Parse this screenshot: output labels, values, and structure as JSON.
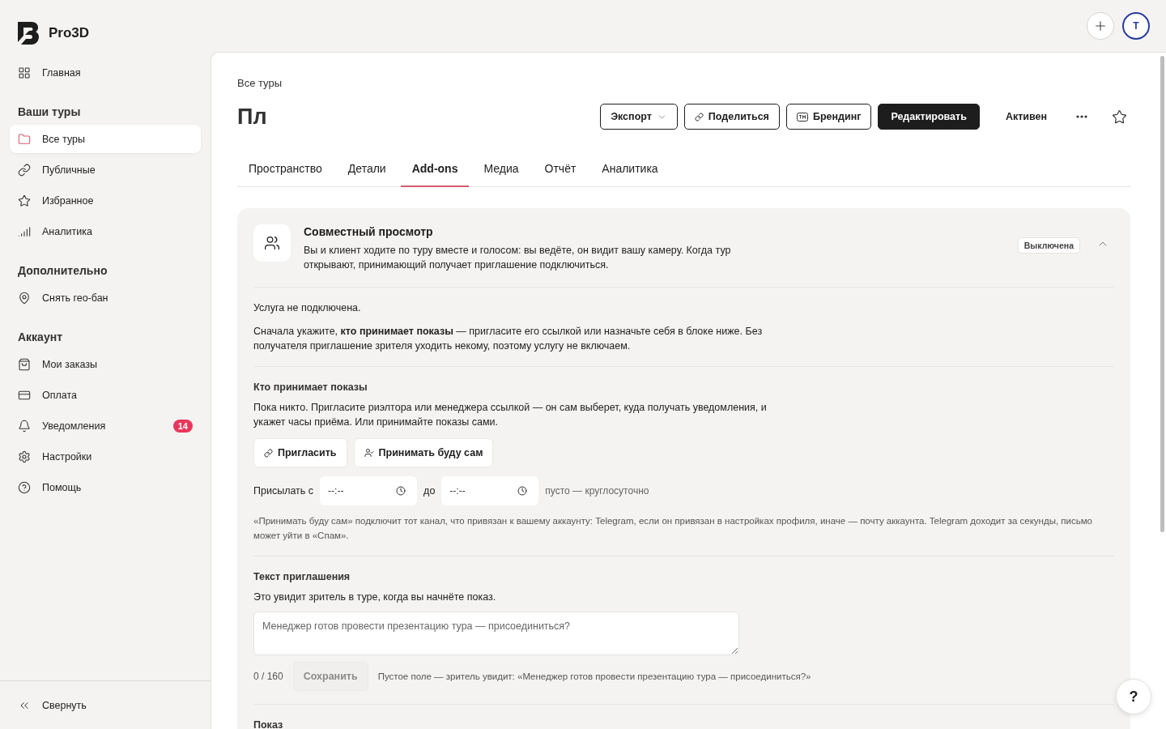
{
  "brand": {
    "name": "Pro3D"
  },
  "sidebar": {
    "top": [
      {
        "label": "Главная",
        "selected": false
      }
    ],
    "sections": [
      {
        "title": "Ваши туры",
        "items": [
          {
            "label": "Все туры",
            "selected": true
          },
          {
            "label": "Публичные",
            "selected": false
          },
          {
            "label": "Избранное",
            "selected": false
          },
          {
            "label": "Аналитика",
            "selected": false
          }
        ]
      },
      {
        "title": "Дополнительно",
        "items": [
          {
            "label": "Снять гео-бан",
            "selected": false
          }
        ]
      },
      {
        "title": "Аккаунт",
        "items": [
          {
            "label": "Мои заказы",
            "selected": false
          },
          {
            "label": "Оплата",
            "selected": false
          },
          {
            "label": "Уведомления",
            "selected": false,
            "badge": "14"
          },
          {
            "label": "Настройки",
            "selected": false
          },
          {
            "label": "Помощь",
            "selected": false
          }
        ]
      }
    ],
    "collapse": "Свернуть"
  },
  "header": {
    "avatar": "T"
  },
  "breadcrumb": "Все туры",
  "title": "Пл",
  "actions": [
    {
      "kind": "dropdown",
      "label": "Экспорт"
    },
    {
      "kind": "outline",
      "label": "Поделиться"
    },
    {
      "kind": "outline",
      "label": "Брендинг"
    },
    {
      "kind": "primary",
      "label": "Редактировать"
    },
    {
      "kind": "text",
      "label": "Активен"
    }
  ],
  "tabs": [
    {
      "label": "Пространство",
      "selected": false
    },
    {
      "label": "Детали",
      "selected": false
    },
    {
      "label": "Add-ons",
      "selected": true
    },
    {
      "label": "Медиа",
      "selected": false
    },
    {
      "label": "Отчёт",
      "selected": false
    },
    {
      "label": "Аналитика",
      "selected": false
    }
  ],
  "addon": {
    "title": "Совместный просмотр",
    "description": "Вы и клиент ходите по туру вместе и голосом: вы ведёте, он видит вашу камеру. Когда тур открывают, принимающий получает приглашение подключиться.",
    "status": "Выключена",
    "expanded": true,
    "status_text": "Услуга не подключена.",
    "intro": "Сначала укажите, **кто принимает показы** — пригласите его ссылкой или назначьте себя в блоке ниже. Без получателя приглашение зрителя уходить некому, поэтому услугу не включаем.",
    "receivers": {
      "heading": "Кто принимает показы",
      "text": "Пока никто. Пригласите риэлтора или менеджера ссылкой — он сам выберет, куда получать уведомления, и укажет часы приёма. Или принимайте показы сами.",
      "buttons": [
        "Пригласить",
        "Принимать буду сам"
      ],
      "from_label": "Присылать с",
      "from_placeholder": "--:--",
      "to_label": "до",
      "to_placeholder": "--:--",
      "hint": "пусто — круглосуточно",
      "note": "«Принимать буду сам» подключит тот канал, что привязан к вашему аккаунту: Telegram, если он привязан в настройках профиля, иначе — почту аккаунта. Telegram доходит за секунды, письмо может уйти в «Спам»."
    },
    "invite": {
      "heading": "Текст приглашения",
      "text": "Это увидит зритель в туре, когда вы начнёте показ.",
      "placeholder": "Менеджер готов провести презентацию тура — присоединиться?",
      "counter": "0 / 160",
      "save": {
        "label": "Сохранить",
        "disabled": true
      },
      "hint": "Пустое поле — зритель увидит: «Менеджер готов провести презентацию тура — присоединиться?»"
    },
    "next_heading": "Показ"
  },
  "help": "?"
}
